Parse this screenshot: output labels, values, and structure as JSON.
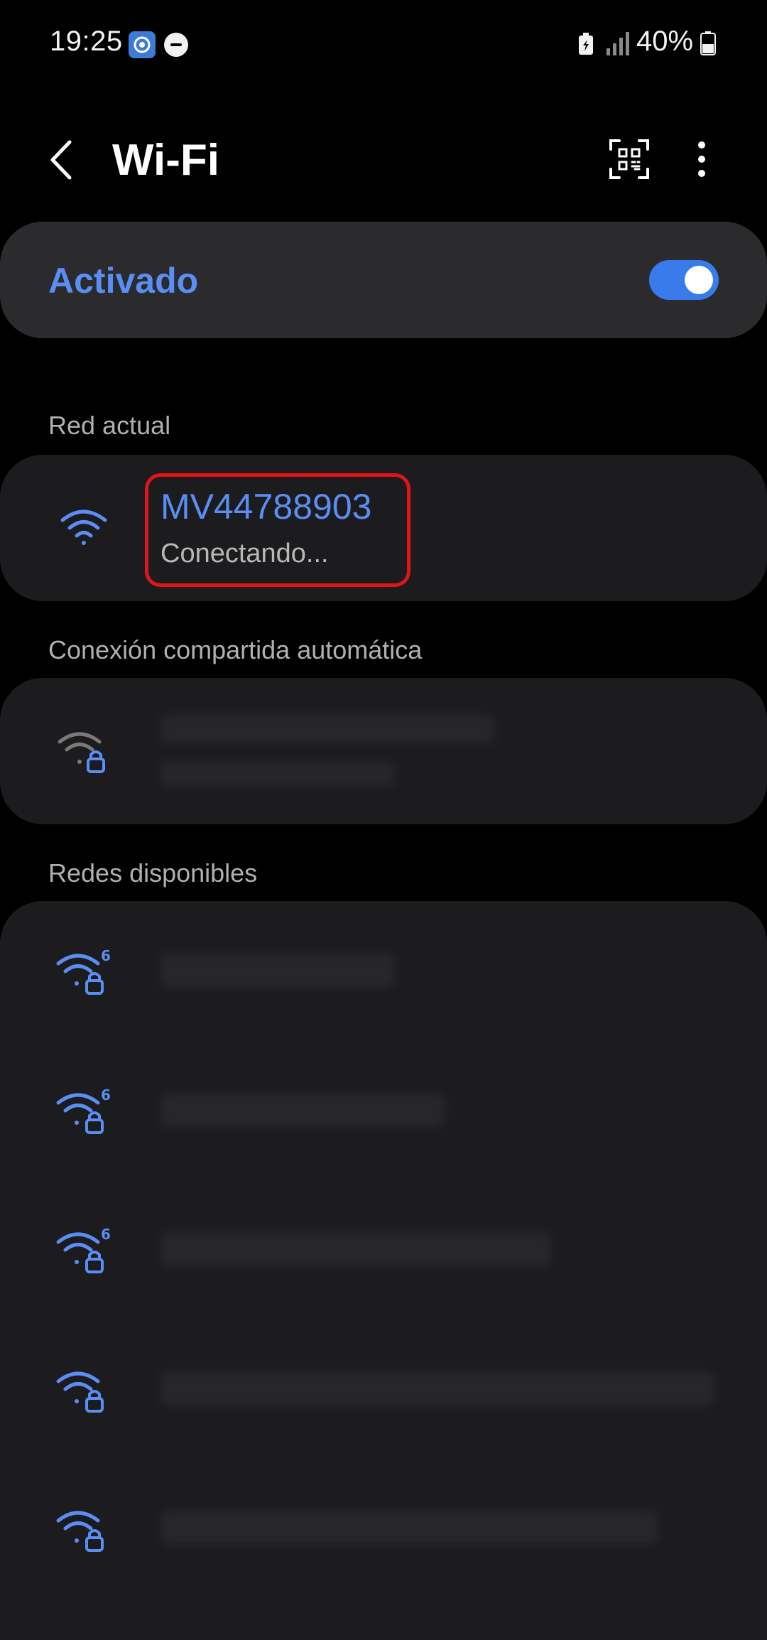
{
  "status_bar": {
    "time": "19:25",
    "battery_percent": "40%",
    "icons": [
      "app-notification-icon",
      "do-not-disturb-icon",
      "battery-saver-icon",
      "signal-icon",
      "battery-icon"
    ]
  },
  "header": {
    "title": "Wi-Fi",
    "icons": [
      "back-arrow-icon",
      "qr-code-scan-icon",
      "more-options-icon"
    ]
  },
  "wifi_toggle": {
    "label": "Activado",
    "on": true
  },
  "current_network": {
    "section_label": "Red actual",
    "name": "MV44788903",
    "status": "Conectando..."
  },
  "auto_hotspot": {
    "section_label": "Conexión compartida automática"
  },
  "available_networks": {
    "section_label": "Redes disponibles",
    "items": [
      {
        "icon": "wifi6-lock-icon"
      },
      {
        "icon": "wifi6-lock-icon"
      },
      {
        "icon": "wifi6-lock-icon"
      },
      {
        "icon": "wifi-lock-icon"
      },
      {
        "icon": "wifi-lock-icon"
      }
    ]
  },
  "colors": {
    "accent": "#5a8ef5",
    "card": "#1c1c1e",
    "toggle_card": "#2b2b2d",
    "highlight": "#e0141a"
  }
}
